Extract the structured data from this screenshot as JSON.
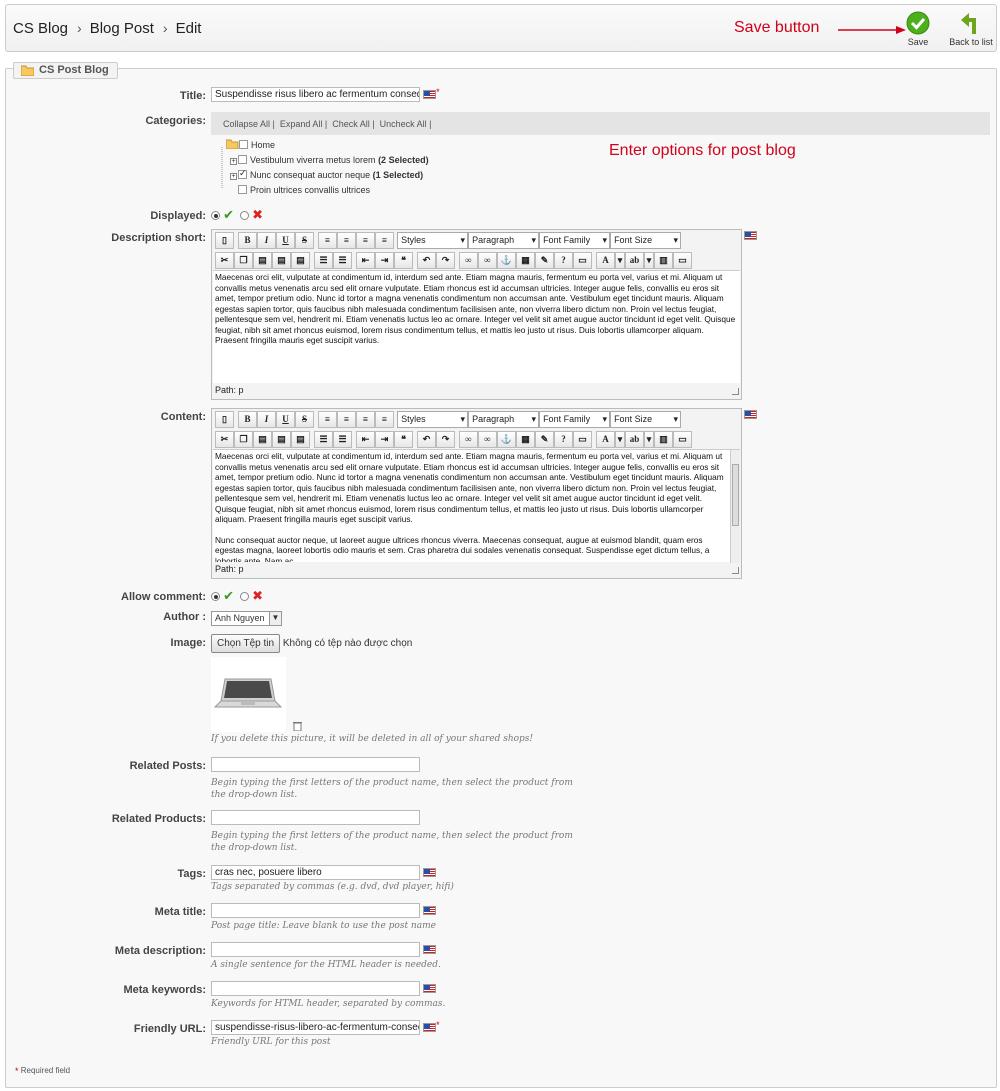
{
  "breadcrumb": [
    "CS Blog",
    "Blog Post",
    "Edit"
  ],
  "annotations": {
    "save": "Save button",
    "options": "Enter options for post blog"
  },
  "toolbar": {
    "save_label": "Save",
    "back_label": "Back to list"
  },
  "panel": {
    "legend": "CS Post Blog",
    "required_note": "Required field"
  },
  "form": {
    "title": {
      "label": "Title:",
      "value": "Suspendisse risus libero ac fermentum consequ"
    },
    "categories": {
      "label": "Categories:",
      "actions": [
        "Collapse All",
        "Expand All",
        "Check All",
        "Uncheck All"
      ],
      "tree": [
        {
          "name": "Home",
          "checked": false
        },
        {
          "name": "Vestibulum viverra metus lorem",
          "count": "(2 Selected)",
          "checked": false
        },
        {
          "name": "Nunc consequat auctor neque",
          "count": "(1 Selected)",
          "checked": true
        },
        {
          "name": "Proin ultrices convallis ultrices",
          "checked": false
        }
      ]
    },
    "displayed": {
      "label": "Displayed:",
      "value": "yes"
    },
    "description_short": {
      "label": "Description short:",
      "text": "Maecenas orci elit, vulputate at condimentum id, interdum sed ante. Etiam magna mauris, fermentum eu porta vel, varius et mi. Aliquam ut convallis metus venenatis arcu sed elit ornare vulputate. Etiam rhoncus est id accumsan ultricies. Integer augue felis, convallis eu eros sit amet, tempor pretium odio. Nunc id tortor a magna venenatis condimentum non accumsan ante. Vestibulum eget tincidunt mauris. Aliquam egestas sapien tortor, quis faucibus nibh malesuada condimentum facilisisen ante, non viverra libero dictum non. Proin vel lectus feugiat, pellentesque sem vel, hendrerit mi. Etiam venenatis luctus leo ac ornare. Integer vel velit sit amet augue auctor tincidunt id eget velit. Quisque feugiat, nibh sit amet rhoncus euismod, lorem risus condimentum tellus, et mattis leo justo ut risus. Duis lobortis ullamcorper aliquam. Praesent fringilla mauris eget suscipit varius.",
      "path": "Path: p"
    },
    "content": {
      "label": "Content:",
      "para1": "Maecenas orci elit, vulputate at condimentum id, interdum sed ante. Etiam magna mauris, fermentum eu porta vel, varius et mi. Aliquam ut convallis metus venenatis arcu sed elit ornare vulputate. Etiam rhoncus est id accumsan ultricies. Integer augue felis, convallis eu eros sit amet, tempor pretium odio. Nunc id tortor a magna venenatis condimentum non accumsan ante. Vestibulum eget tincidunt mauris. Aliquam egestas sapien tortor, quis faucibus nibh malesuada condimentum facilisisen ante, non viverra libero dictum non. Proin vel lectus feugiat, pellentesque sem vel, hendrerit mi. Etiam venenatis luctus leo ac ornare. Integer vel velit sit amet augue auctor tincidunt id eget velit. Quisque feugiat, nibh sit amet rhoncus euismod, lorem risus condimentum tellus, et mattis leo justo ut risus. Duis lobortis ullamcorper aliquam. Praesent fringilla mauris eget suscipit varius.",
      "para2": "Nunc consequat auctor neque, ut laoreet augue ultrices rhoncus viverra. Maecenas consequat, augue at euismod blandit, quam eros egestas magna, laoreet lobortis odio mauris et sem. Cras pharetra dui sodales venenatis consequat. Suspendisse eget dictum tellus, a lobortis ante. Nam ac",
      "path": "Path: p"
    },
    "editor_selects": [
      "Styles",
      "Paragraph",
      "Font Family",
      "Font Size"
    ],
    "allow_comment": {
      "label": "Allow comment:",
      "value": "yes"
    },
    "author": {
      "label": "Author :",
      "value": "Anh Nguyen"
    },
    "image": {
      "label": "Image:",
      "button": "Chọn Tệp tin",
      "status": "Không có tệp nào được chọn",
      "hint": "If you delete this picture, it will be deleted in all of your shared shops!"
    },
    "related_posts": {
      "label": "Related Posts:",
      "value": "",
      "hint": "Begin typing the first letters of the product name, then select the product from the drop-down list."
    },
    "related_products": {
      "label": "Related Products:",
      "value": "",
      "hint": "Begin typing the first letters of the product name, then select the product from the drop-down list."
    },
    "tags": {
      "label": "Tags:",
      "value": "cras nec, posuere libero",
      "hint": "Tags separated by commas (e.g. dvd, dvd player, hifi)"
    },
    "meta_title": {
      "label": "Meta title:",
      "value": "",
      "hint": "Post page title: Leave blank to use the post name"
    },
    "meta_description": {
      "label": "Meta description:",
      "value": "",
      "hint": "A single sentence for the HTML header is needed."
    },
    "meta_keywords": {
      "label": "Meta keywords:",
      "value": "",
      "hint": "Keywords for HTML header, separated by commas."
    },
    "friendly_url": {
      "label": "Friendly URL:",
      "value": "suspendisse-risus-libero-ac-fermentum-conseq",
      "hint": "Friendly URL for this post"
    }
  },
  "colors": {
    "annotation": "#d0021b",
    "save_green": "#4caf1c",
    "back_green": "#6ea51f"
  }
}
